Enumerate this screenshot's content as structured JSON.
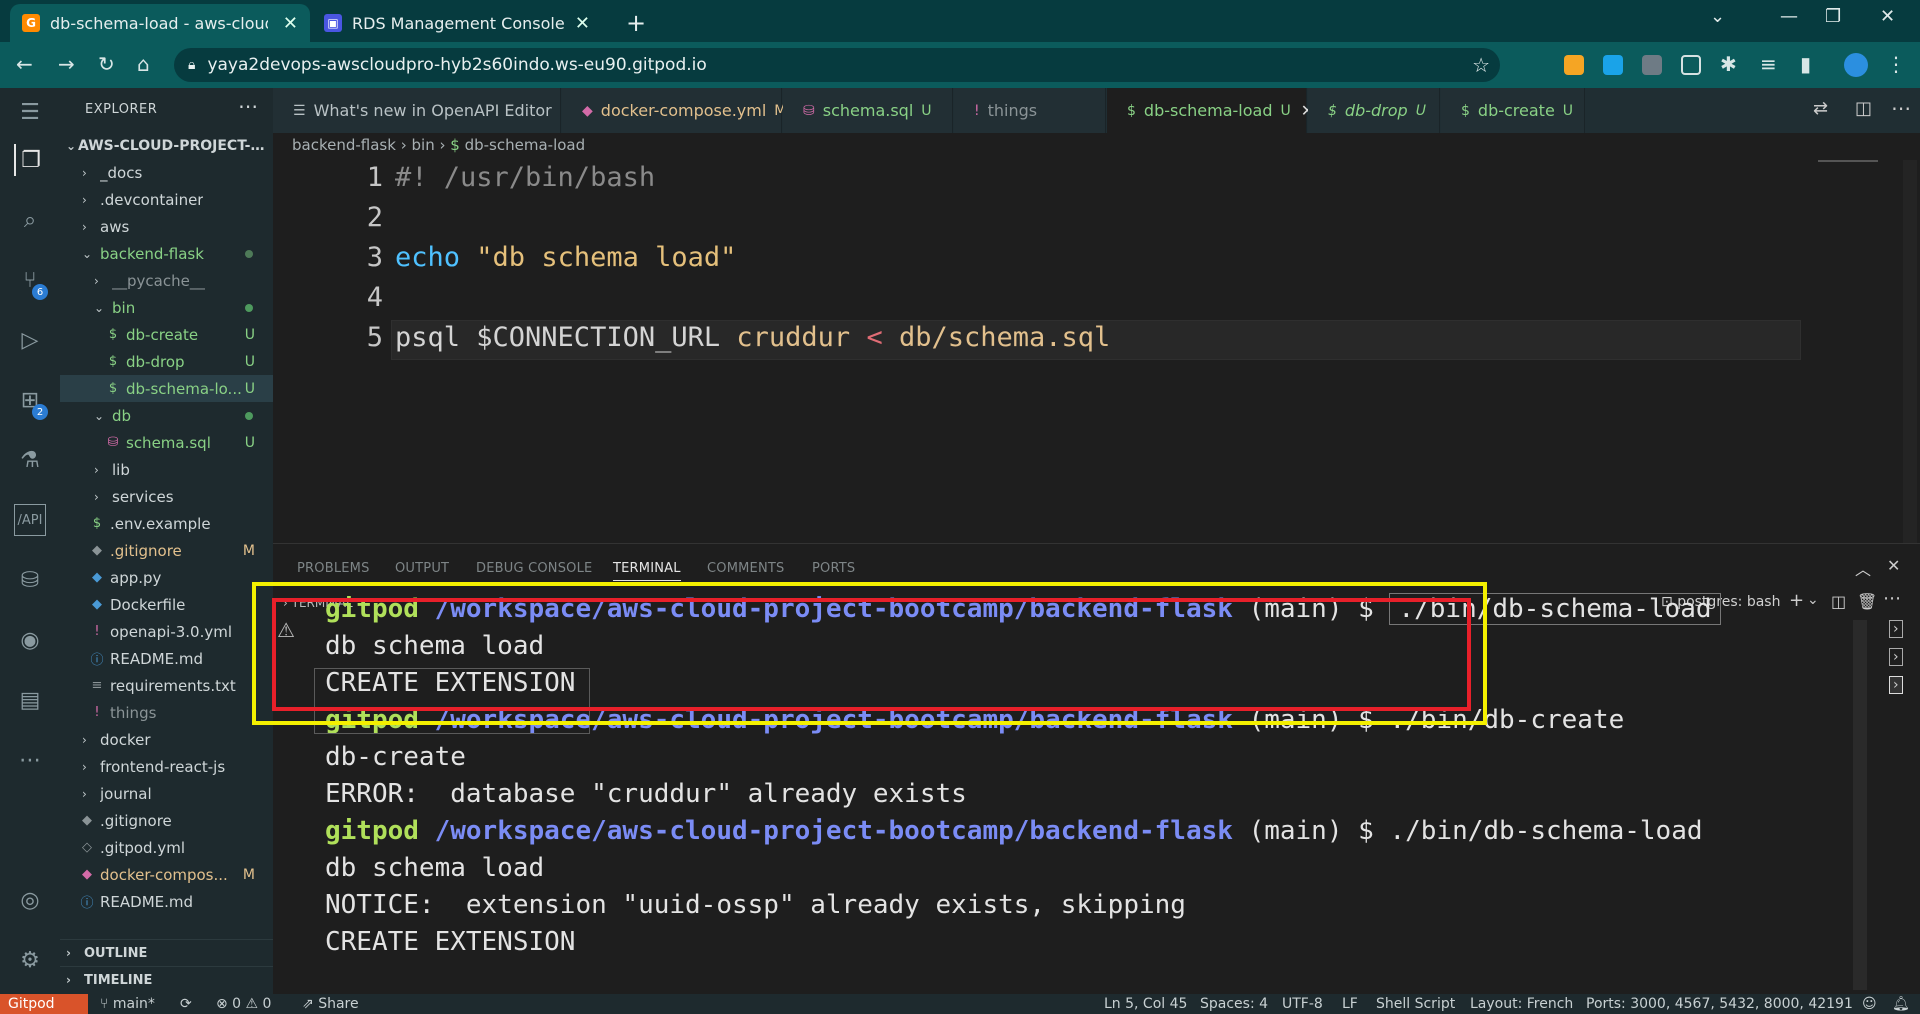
{
  "browser": {
    "tabs": [
      {
        "title": "db-schema-load - aws-cloud-project",
        "active": true
      },
      {
        "title": "RDS Management Console",
        "active": false
      }
    ],
    "new_tab": "+",
    "url": "yaya2devops-awscloudpro-hyb2s60indo.ws-eu90.gitpod.io"
  },
  "activity": {
    "scm_badge": "6",
    "ext_badge": "2"
  },
  "explorer": {
    "header": "EXPLORER",
    "root": "AWS-CLOUD-PROJECT-BO...",
    "items": [
      {
        "label": "_docs",
        "status": ""
      },
      {
        "label": ".devcontainer",
        "status": ""
      },
      {
        "label": "aws",
        "status": ""
      },
      {
        "label": "backend-flask",
        "status": ""
      },
      {
        "label": "__pycache__",
        "status": ""
      },
      {
        "label": "bin",
        "status": ""
      },
      {
        "label": "db-create",
        "status": "U"
      },
      {
        "label": "db-drop",
        "status": "U"
      },
      {
        "label": "db-schema-lo...",
        "status": "U"
      },
      {
        "label": "db",
        "status": ""
      },
      {
        "label": "schema.sql",
        "status": "U"
      },
      {
        "label": "lib",
        "status": ""
      },
      {
        "label": "services",
        "status": ""
      },
      {
        "label": ".env.example",
        "status": ""
      },
      {
        "label": ".gitignore",
        "status": "M"
      },
      {
        "label": "app.py",
        "status": ""
      },
      {
        "label": "Dockerfile",
        "status": ""
      },
      {
        "label": "openapi-3.0.yml",
        "status": ""
      },
      {
        "label": "README.md",
        "status": ""
      },
      {
        "label": "requirements.txt",
        "status": ""
      },
      {
        "label": "things",
        "status": ""
      },
      {
        "label": "docker",
        "status": ""
      },
      {
        "label": "frontend-react-js",
        "status": ""
      },
      {
        "label": "journal",
        "status": ""
      },
      {
        "label": ".gitignore",
        "status": ""
      },
      {
        "label": ".gitpod.yml",
        "status": ""
      },
      {
        "label": "docker-compos...",
        "status": "M"
      },
      {
        "label": "README.md",
        "status": ""
      }
    ],
    "outline": "OUTLINE",
    "timeline": "TIMELINE"
  },
  "editor_tabs": [
    {
      "label": "What's new in OpenAPI Editor",
      "status": ""
    },
    {
      "label": "docker-compose.yml",
      "status": "M"
    },
    {
      "label": "schema.sql",
      "status": "U"
    },
    {
      "label": "things",
      "status": ""
    },
    {
      "label": "db-schema-load",
      "status": "U"
    },
    {
      "label": "db-drop",
      "status": "U"
    },
    {
      "label": "db-create",
      "status": "U"
    }
  ],
  "breadcrumb": [
    "backend-flask",
    "bin",
    "db-schema-load"
  ],
  "code": {
    "line_numbers": [
      "1",
      "2",
      "3",
      "4",
      "5"
    ],
    "line1": "#! /usr/bin/bash",
    "line3_cmd": "echo",
    "line3_str": "\"db schema load\"",
    "line5_cmd": "psql $CONNECTION_URL",
    "line5_db": "cruddur",
    "line5_op": "<",
    "line5_file": "db/schema.sql"
  },
  "panel": {
    "tabs": [
      "PROBLEMS",
      "OUTPUT",
      "DEBUG CONSOLE",
      "TERMINAL",
      "COMMENTS",
      "PORTS"
    ],
    "active_tab": "TERMINAL",
    "terminal_header": "TERMINAL",
    "terminal_instance": "postgres: bash"
  },
  "terminal": {
    "user": "gitpod",
    "path": "/workspace/aws-cloud-project-bootcamp/backend-flask",
    "branch": "(main) $",
    "cmd1": "./bin/db-schema-load",
    "out1a": "db schema load",
    "out1b": "CREATE EXTENSION",
    "cmd2": "./bin/db-create",
    "out2a": "db-create",
    "out2b": "ERROR:  database \"cruddur\" already exists",
    "cmd3": "./bin/db-schema-load",
    "out3a": "db schema load",
    "out3b": "NOTICE:  extension \"uuid-ossp\" already exists, skipping",
    "out3c": "CREATE EXTENSION"
  },
  "statusbar": {
    "gitpod": "Gitpod",
    "branch": "main*",
    "problems": "⊗ 0 ⚠ 0",
    "share": "Share",
    "position": "Ln 5, Col 45",
    "spaces": "Spaces: 4",
    "encoding": "UTF-8",
    "eol": "LF",
    "language": "Shell Script",
    "layout": "Layout: French",
    "ports": "Ports: 3000, 4567, 5432, 8000, 42191"
  },
  "colors": {
    "highlight_outer": "#f4f000",
    "highlight_inner": "#e8202a",
    "accent": "#0b5b5c"
  }
}
